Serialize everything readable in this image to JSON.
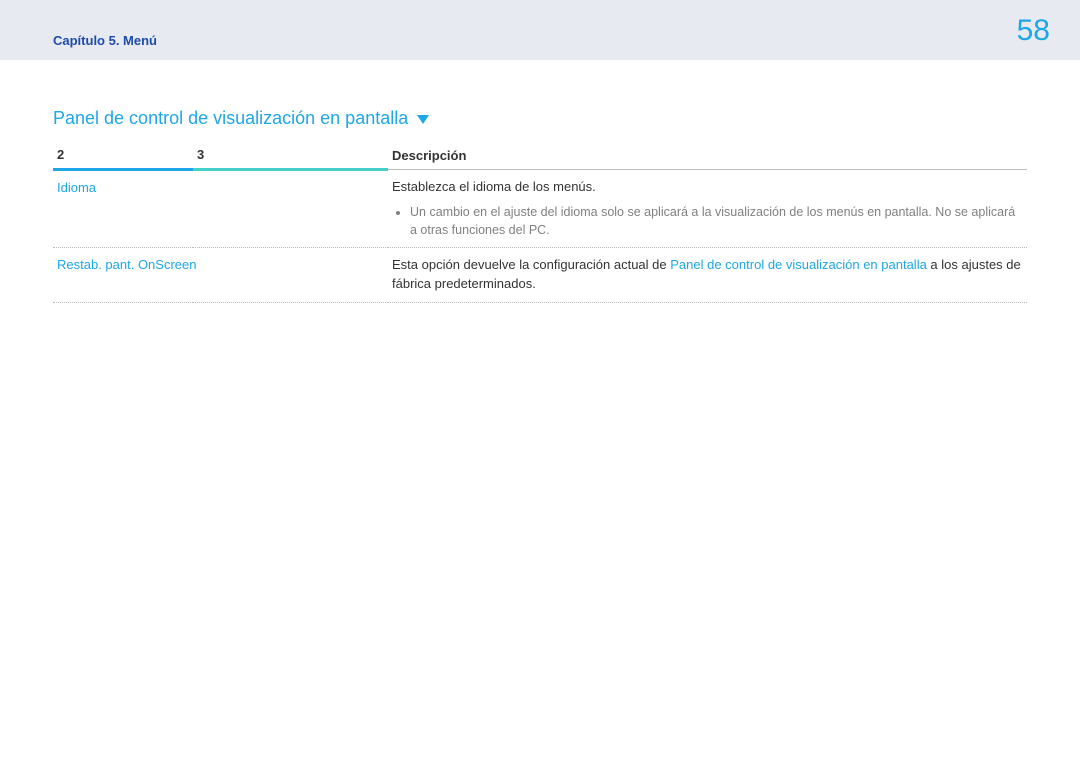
{
  "header": {
    "chapter": "Capítulo 5. Menú",
    "page_number": "58"
  },
  "section": {
    "title": "Panel de control de visualización en pantalla"
  },
  "table": {
    "headers": {
      "col1": "2",
      "col2": "3",
      "col3": "Descripción"
    },
    "rows": [
      {
        "name": "Idioma",
        "sub": "",
        "desc_main": "Establezca el idioma de los menús.",
        "bullet": "Un cambio en el ajuste del idioma solo se aplicará a la visualización de los menús en pantalla. No se aplicará a otras funciones del PC."
      },
      {
        "name": "Restab. pant. OnScreen",
        "sub": "",
        "desc_pre": "Esta opción devuelve la configuración actual de ",
        "desc_link": "Panel de control de visualización en pantalla",
        "desc_post": " a los ajustes de fábrica predeterminados."
      }
    ]
  }
}
